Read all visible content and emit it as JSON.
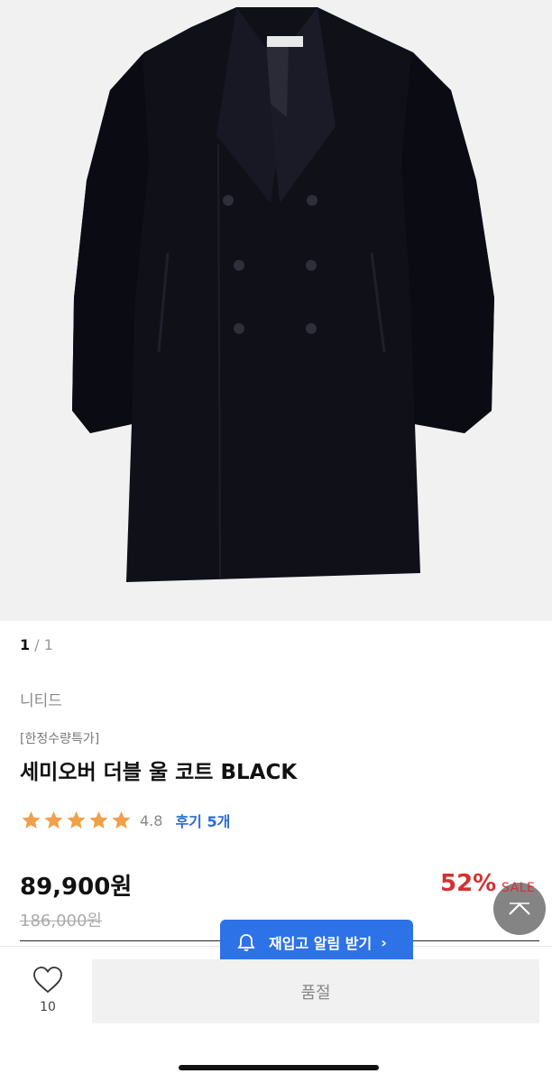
{
  "gallery": {
    "current": "1",
    "separator": "/",
    "total": "1"
  },
  "product": {
    "brand": "니티드",
    "tag": "[한정수량특가]",
    "title": "세미오버 더블 울 코트 BLACK",
    "rating_stars": 5,
    "rating": "4.8",
    "review_label": "후기 5개",
    "price": "89,900원",
    "original_price": "186,000원",
    "discount": "52%",
    "sale_label": "SALE"
  },
  "actions": {
    "restock_alert": "재입고 알림 받기",
    "restock_chevron": "›",
    "like_count": "10",
    "soldout_label": "품절"
  },
  "colors": {
    "accent_blue": "#2d72e6",
    "sale_red": "#d43232",
    "star": "#f0a04b"
  },
  "icons": [
    "bell-icon",
    "heart-icon",
    "star-icon",
    "chevron-up-icon",
    "chevron-right-icon"
  ]
}
